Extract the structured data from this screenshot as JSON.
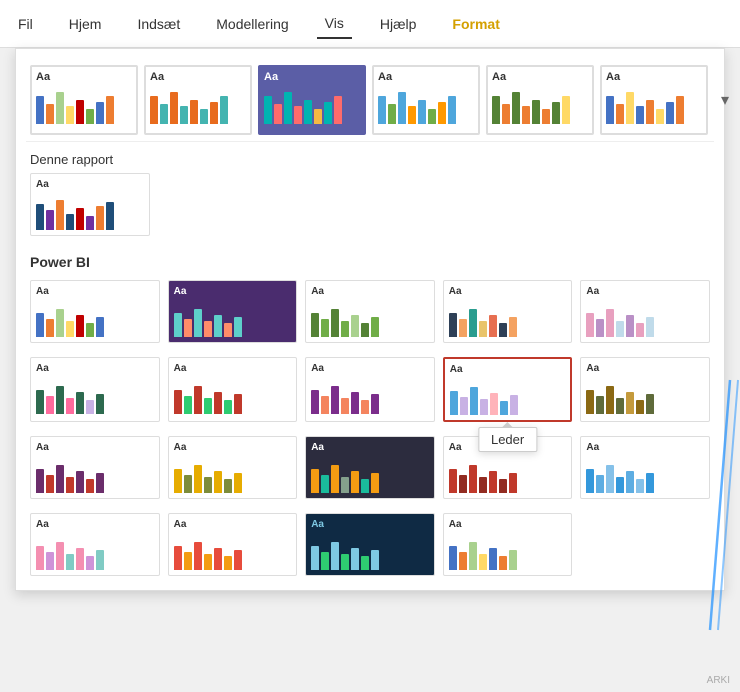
{
  "menu": {
    "items": [
      {
        "label": "Fil",
        "id": "fil",
        "active": false,
        "highlight": false
      },
      {
        "label": "Hjem",
        "id": "hjem",
        "active": false,
        "highlight": false
      },
      {
        "label": "Indsæt",
        "id": "indsaet",
        "active": false,
        "highlight": false
      },
      {
        "label": "Modellering",
        "id": "modellering",
        "active": false,
        "highlight": false
      },
      {
        "label": "Vis",
        "id": "vis",
        "active": true,
        "highlight": false
      },
      {
        "label": "Hjælp",
        "id": "hjaelp",
        "active": false,
        "highlight": false
      },
      {
        "label": "Format",
        "id": "format",
        "active": false,
        "highlight": true
      }
    ]
  },
  "panel": {
    "section_this_report": "Denne rapport",
    "section_power_bi": "Power BI",
    "scroll_symbol": "▾",
    "tooltip_label": "Leder"
  }
}
